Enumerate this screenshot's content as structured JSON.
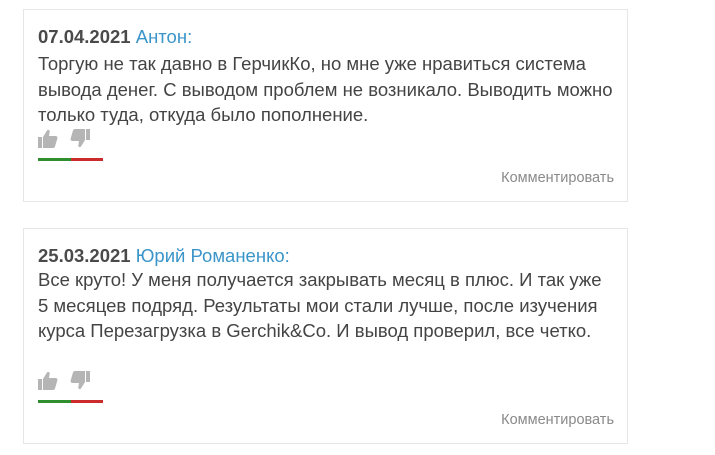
{
  "comments": [
    {
      "date": "07.04.2021",
      "author": "Антон",
      "author_suffix": ":",
      "text": "Торгую не так давно в ГерчикКо, но мне уже нравиться система вывода денег. С выводом проблем не возникало. Выводить можно только туда, откуда было пополнение.",
      "up_icon": "thumbs-up-icon",
      "down_icon": "thumbs-down-icon",
      "rating_positive_fraction": 0.5,
      "colors": {
        "positive": "#2f8f2f",
        "negative": "#cc2b2b"
      },
      "reply_label": "Комментировать"
    },
    {
      "date": "25.03.2021",
      "author": "Юрий Романенко",
      "author_suffix": ":",
      "text": "Все круто! У меня получается закрывать месяц в плюс. И так уже 5 месяцев подряд. Результаты мои стали лучше, после изучения курса Перезагрузка в Gerchik&Co. И вывод проверил, все четко.",
      "up_icon": "thumbs-up-icon",
      "down_icon": "thumbs-down-icon",
      "rating_positive_fraction": 0.5,
      "colors": {
        "positive": "#2f8f2f",
        "negative": "#cc2b2b"
      },
      "reply_label": "Комментировать"
    }
  ],
  "theme": {
    "author_color": "#3a95c9",
    "text_color": "#444444",
    "icon_color": "#b5b5b5",
    "border_color": "#e6e6e6"
  }
}
